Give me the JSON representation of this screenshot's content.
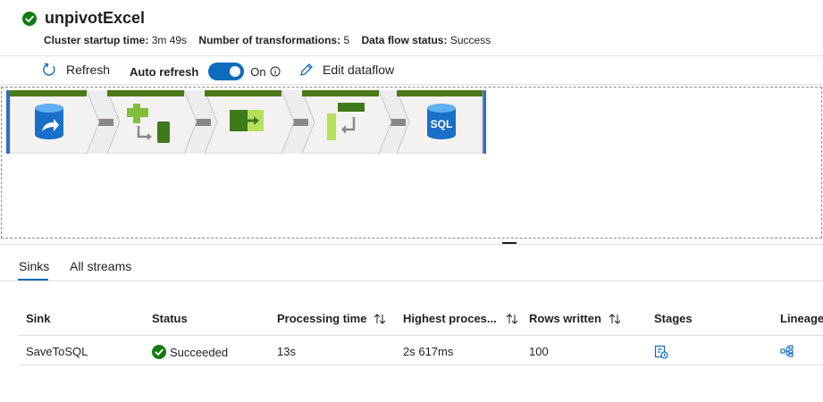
{
  "header": {
    "title": "unpivotExcel",
    "status_icon": "success-check-icon",
    "meta": {
      "startup_label": "Cluster startup time:",
      "startup_value": "3m 49s",
      "transformations_label": "Number of transformations:",
      "transformations_value": "5",
      "status_label": "Data flow status:",
      "status_value": "Success"
    }
  },
  "toolbar": {
    "refresh_label": "Refresh",
    "auto_refresh_label": "Auto refresh",
    "auto_refresh_state": "On",
    "edit_label": "Edit dataflow"
  },
  "pipeline": {
    "nodes": [
      {
        "icon": "source-database-icon"
      },
      {
        "icon": "unpivot-transform-icon"
      },
      {
        "icon": "derived-column-icon"
      },
      {
        "icon": "select-transform-icon"
      },
      {
        "icon": "sql-sink-icon",
        "label": "SQL"
      }
    ]
  },
  "tabs": [
    "Sinks",
    "All streams"
  ],
  "table": {
    "columns": [
      "Sink",
      "Status",
      "Processing time",
      "Highest proces...",
      "Rows written",
      "Stages",
      "Lineage"
    ],
    "rows": [
      {
        "sink": "SaveToSQL",
        "status": "Succeeded",
        "processing_time": "13s",
        "highest": "2s 617ms",
        "rows_written": "100"
      }
    ]
  },
  "colors": {
    "accent": "#0f6cbd",
    "success": "#107c10",
    "node_header": "#4c7a1a"
  }
}
